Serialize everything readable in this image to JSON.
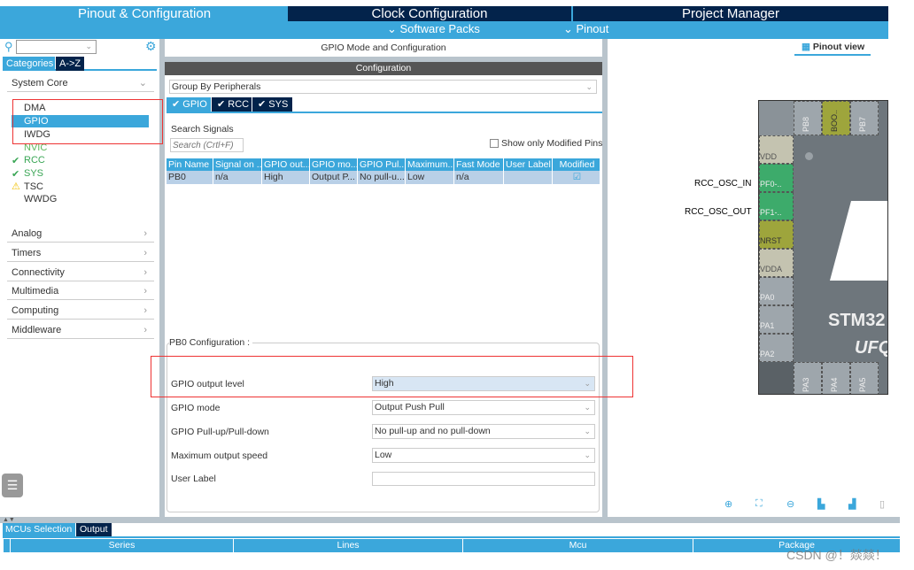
{
  "top_tabs": [
    {
      "label": "Pinout & Configuration",
      "active": true
    },
    {
      "label": "Clock Configuration"
    },
    {
      "label": "Project Manager"
    }
  ],
  "sub_menu": {
    "software_packs": "Software Packs",
    "pinout": "Pinout"
  },
  "left": {
    "tabs": [
      "Categories",
      "A->Z"
    ],
    "system_core": "System Core",
    "items": [
      {
        "label": "DMA",
        "status": "none"
      },
      {
        "label": "GPIO",
        "status": "selected"
      },
      {
        "label": "IWDG",
        "status": "none"
      },
      {
        "label": "NVIC",
        "status": "ok"
      },
      {
        "label": "RCC",
        "status": "check"
      },
      {
        "label": "SYS",
        "status": "check"
      },
      {
        "label": "TSC",
        "status": "warning"
      },
      {
        "label": "WWDG",
        "status": "none"
      }
    ],
    "categories": [
      "Analog",
      "Timers",
      "Connectivity",
      "Multimedia",
      "Computing",
      "Middleware"
    ]
  },
  "middle": {
    "title": "GPIO Mode and Configuration",
    "config_header": "Configuration",
    "group_by": "Group By Peripherals",
    "tabs": [
      "GPIO",
      "RCC",
      "SYS"
    ],
    "search_label": "Search Signals",
    "search_placeholder": "Search (Crtl+F)",
    "show_modified": "Show only Modified Pins",
    "table": {
      "headers": [
        "Pin Name",
        "Signal on ...",
        "GPIO out...",
        "GPIO mo...",
        "GPIO Pul...",
        "Maximum...",
        "Fast Mode",
        "User Label",
        "Modified"
      ],
      "rows": [
        [
          "PB0",
          "n/a",
          "High",
          "Output P...",
          "No pull-u...",
          "Low",
          "n/a",
          "",
          ""
        ]
      ],
      "modified_checked": true
    },
    "pb0": {
      "legend": "PB0 Configuration :",
      "fields": [
        {
          "label": "GPIO output level",
          "value": "High"
        },
        {
          "label": "GPIO mode",
          "value": "Output Push Pull"
        },
        {
          "label": "GPIO Pull-up/Pull-down",
          "value": "No pull-up and no pull-down"
        },
        {
          "label": "Maximum output speed",
          "value": "Low"
        },
        {
          "label": "User Label",
          "value": ""
        }
      ]
    }
  },
  "right": {
    "pinout_view": "Pinout view",
    "signal_in": "RCC_OSC_IN",
    "signal_out": "RCC_OSC_OUT",
    "top_pins": [
      "PB8",
      "BOO..",
      "PB7"
    ],
    "left_pins": [
      "VDD",
      "PF0-..",
      "PF1-..",
      "NRST",
      "VDDA",
      "PA0",
      "PA1",
      "PA2"
    ],
    "bottom_pins": [
      "PA3",
      "PA4",
      "PA5"
    ],
    "chip_text": "STM32",
    "chip_sub": "UFQ"
  },
  "bottom": {
    "tabs": [
      "MCUs Selection",
      "Output"
    ],
    "headers": [
      "Series",
      "Lines",
      "Mcu",
      "Package"
    ]
  },
  "watermark": "CSDN @！燚燚！"
}
